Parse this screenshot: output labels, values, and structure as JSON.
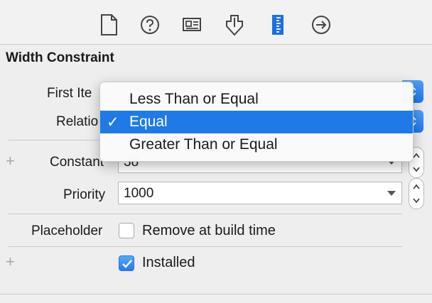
{
  "toolbar": {
    "icons": [
      "file-inspector-icon",
      "quick-help-icon",
      "identity-inspector-icon",
      "attributes-inspector-icon",
      "size-inspector-icon",
      "connections-inspector-icon"
    ],
    "active_color": "#1f6fe0"
  },
  "section": {
    "title": "Width Constraint"
  },
  "rows": {
    "first_item_label": "First Ite",
    "relation_label": "Relatio",
    "constant_label": "Constant",
    "constant_value": "38",
    "priority_label": "Priority",
    "priority_value": "1000",
    "placeholder_label": "Placeholder",
    "remove_label": "Remove at build time",
    "installed_label": "Installed"
  },
  "checkboxes": {
    "remove_at_build_time": false,
    "installed": true
  },
  "menu": {
    "items": [
      {
        "label": "Less Than or Equal",
        "selected": false
      },
      {
        "label": "Equal",
        "selected": true
      },
      {
        "label": "Greater Than or Equal",
        "selected": false
      }
    ],
    "check_glyph": "✓",
    "highlight_color": "#1f7ae8"
  }
}
